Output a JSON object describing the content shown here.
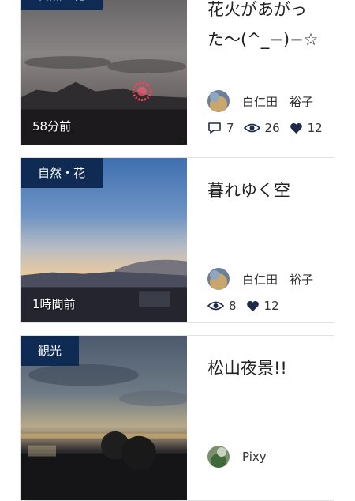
{
  "cards": [
    {
      "category": "自然・花",
      "time": "58分前",
      "title": "花火があがった〜(^_−)−☆",
      "author": "白仁田　裕子",
      "stats": {
        "comments": "7",
        "views": "26",
        "likes": "12"
      }
    },
    {
      "category": "自然・花",
      "time": "1時間前",
      "title": "暮れゆく空",
      "author": "白仁田　裕子",
      "stats": {
        "views": "8",
        "likes": "12"
      }
    },
    {
      "category": "観光",
      "title": "松山夜景!!",
      "author": "Pixy"
    }
  ],
  "colors": {
    "badge": "#0f2b54",
    "icon": "#1e2a4a"
  },
  "icons": [
    "comment-icon",
    "eye-icon",
    "heart-icon"
  ]
}
